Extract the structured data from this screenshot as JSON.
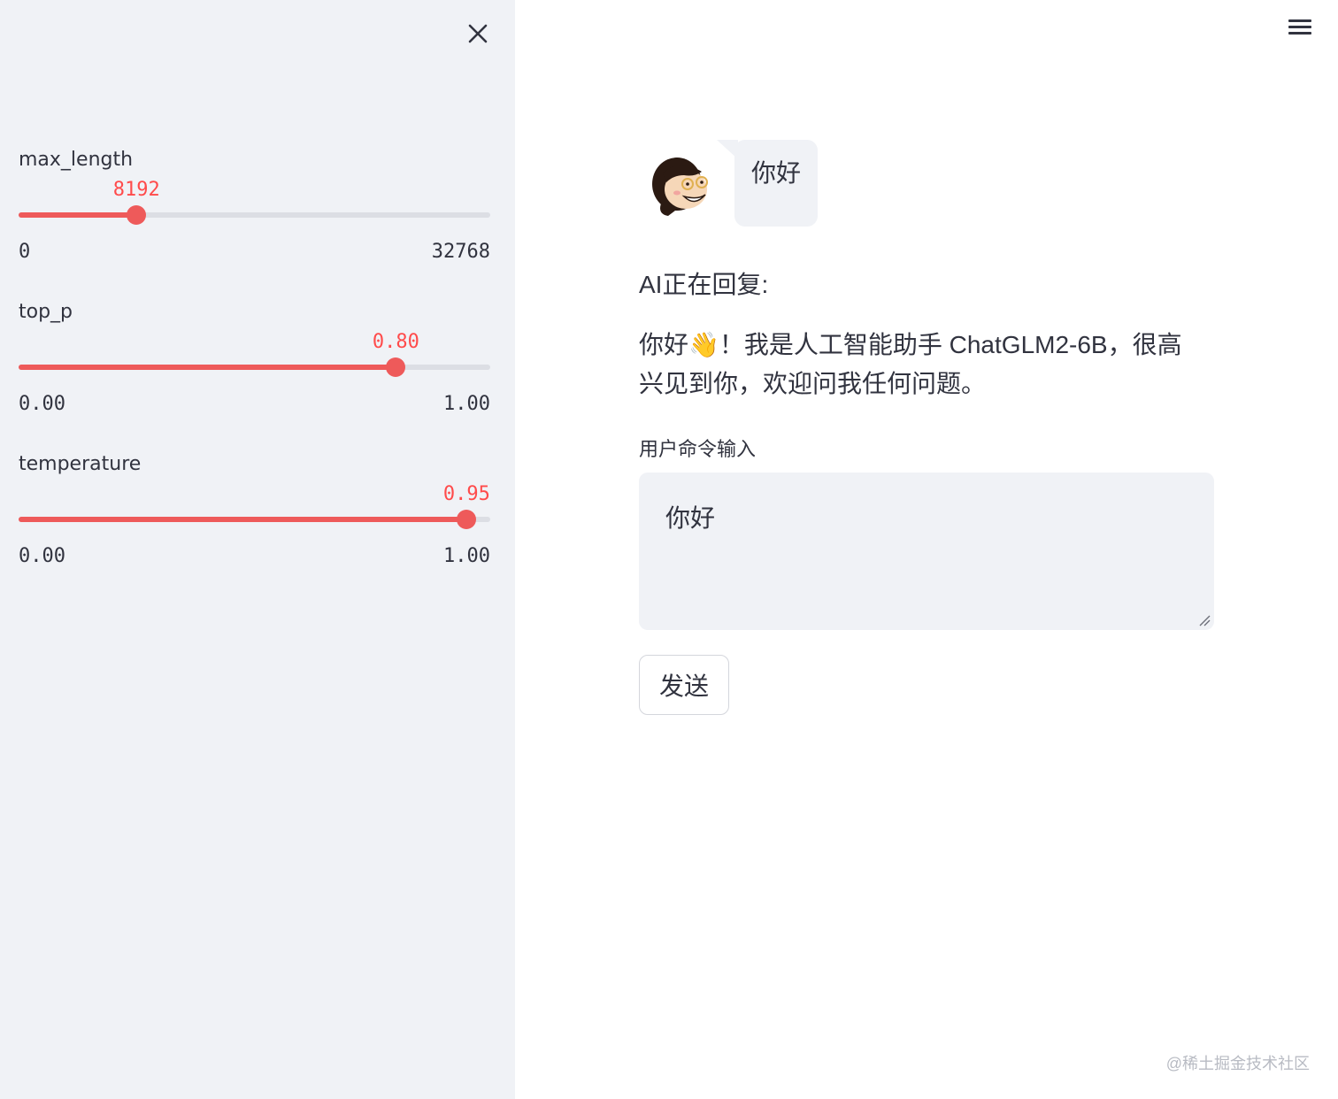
{
  "sidebar": {
    "close_icon": "close-icon",
    "sliders": [
      {
        "label": "max_length",
        "value": "8192",
        "min": "0",
        "max": "32768",
        "fraction": 0.25
      },
      {
        "label": "top_p",
        "value": "0.80",
        "min": "0.00",
        "max": "1.00",
        "fraction": 0.8
      },
      {
        "label": "temperature",
        "value": "0.95",
        "min": "0.00",
        "max": "1.00",
        "fraction": 0.95
      }
    ]
  },
  "header": {
    "menu_icon": "hamburger-menu-icon"
  },
  "chat": {
    "user_message": "你好",
    "avatar_icon": "user-avatar-icon",
    "ai_status": "AI正在回复:",
    "ai_reply": "你好👋！我是人工智能助手 ChatGLM2-6B，很高兴见到你，欢迎问我任何问题。"
  },
  "input": {
    "label": "用户命令输入",
    "value": "你好",
    "send_label": "发送"
  },
  "watermark": "@稀土掘金技术社区",
  "colors": {
    "accent": "#ff4b4b",
    "sidebar_bg": "#f0f2f6",
    "text": "#31333f"
  }
}
